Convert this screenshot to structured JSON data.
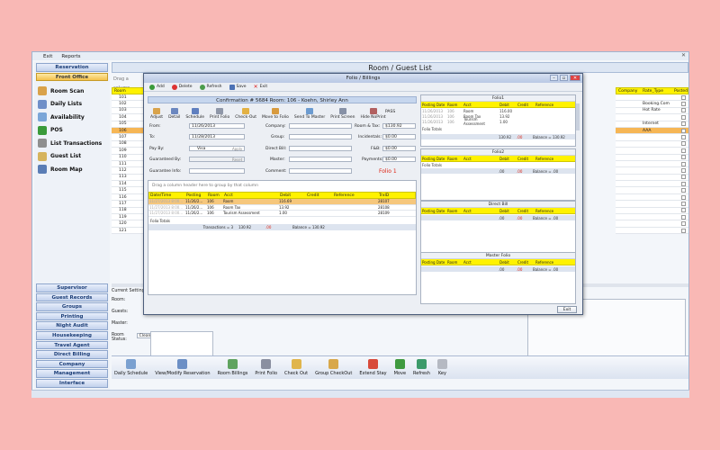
{
  "menubar": {
    "items": [
      "Exit",
      "Reports"
    ]
  },
  "sidebar": {
    "top_buttons": [
      "Reservation",
      "Front Office"
    ],
    "items": [
      "Room Scan",
      "Daily Lists",
      "Availability",
      "POS",
      "List Transactions",
      "Guest List",
      "Room Map"
    ],
    "bottom_buttons": [
      "Supervisor",
      "Guest Records",
      "Groups",
      "Printing",
      "Night Audit",
      "Housekeeping",
      "Travel Agent",
      "Direct Billing",
      "Company",
      "Management",
      "Interface"
    ]
  },
  "main": {
    "title": "Room / Guest List",
    "drag_hint": "Drag a column",
    "col_room": "Room",
    "col_company": "Company",
    "col_rate_type": "Rate_Type",
    "col_posted": "Posted",
    "rooms": [
      "101",
      "102",
      "103",
      "104",
      "105",
      "106",
      "107",
      "108",
      "109",
      "110",
      "111",
      "112",
      "113",
      "114",
      "115",
      "116",
      "117",
      "118",
      "119",
      "120",
      "121"
    ],
    "rate_types": {
      "r102": "Booking.Com",
      "r103": "Hot Rate",
      "r105": "Internet",
      "r106": "AAA"
    },
    "current_settings": "Current Settings",
    "lbl_room": "Room:",
    "lbl_guests": "Guests:",
    "lbl_master": "Master:",
    "lbl_room_status": "Room Status:",
    "room_status_val": "Clean",
    "lbl_room_notes": "Room Notes:",
    "company_notes": "Company Notes:",
    "save": "Save",
    "exit": "Exit"
  },
  "toolbar": [
    "Daily Schedule",
    "View/Modify Reservation",
    "Room Billings",
    "Print Folio",
    "Check Out",
    "Group CheckOut",
    "Extend Stay",
    "Move",
    "Refresh",
    "Key"
  ],
  "dialog": {
    "title": "Folio / Billings",
    "tb": [
      "Add",
      "Delete",
      "Refresh",
      "Save",
      "Exit"
    ],
    "confirmation": "Confirmation # 5684 Room: 106 -  Koehn, Shirley Ann",
    "actions": [
      "Adjust",
      "Detail",
      "Schedule",
      "Print Folio",
      "Check-Out",
      "Move to Folio",
      "Send To Master",
      "Print Screen",
      "Hide NoPrint"
    ],
    "pass": "PASS",
    "lbl_from": "From:",
    "from": "11/26/2013",
    "lbl_to": "To:",
    "to": "11/28/2013",
    "lbl_payby": "Pay By:",
    "payby": "Visa",
    "apply": "Apply",
    "lbl_guaranteed": "Guaranteed By:",
    "reset": "Reset",
    "lbl_guar_info": "Guarantee Info:",
    "lbl_company": "Company:",
    "lbl_group": "Group:",
    "lbl_directbill": "Direct Bill:",
    "lbl_master": "Master:",
    "lbl_comment": "Comment:",
    "lbl_roomtax": "Room & Tax:",
    "roomtax": "$130.92",
    "lbl_incidentals": "Incidentals:",
    "incidentals": "$0.00",
    "lbl_f&b": "F&B:",
    "fb": "$0.00",
    "lbl_payments": "Payments:",
    "payments": "$0.00",
    "folio_label": "Folio 1",
    "grid_hint": "Drag a column header here to group by that column",
    "grid_cols": [
      "Date/Time",
      "Posting",
      "Room",
      "Acct",
      "Debit",
      "Credit",
      "Reference",
      "TrxID"
    ],
    "grid_rows": [
      [
        "11/27/2013 8:00...",
        "11/26/2...",
        "106",
        "Room",
        "116.69",
        "",
        "",
        "28107"
      ],
      [
        "11/27/2013 8:00...",
        "11/26/2...",
        "106",
        "Room Tax",
        "13.92",
        "",
        "",
        "28108"
      ],
      [
        "11/27/2013 8:00...",
        "11/26/2...",
        "106",
        "Tourism Assessment",
        "1.00",
        "",
        "",
        "28109"
      ]
    ],
    "folio_totals": "Folio Totals",
    "transactions": "Transactions = 3",
    "debit_total": "130.92",
    "credit_total": ".00",
    "balance_total": "Balance = 130.92",
    "exit": "Exit",
    "folios": [
      {
        "title": "Folio1",
        "cols": [
          "Posting Date",
          "Room",
          "Acct",
          "Debit",
          "Credit",
          "Reference"
        ],
        "rows": [
          [
            "11/26/2013",
            "106",
            "Room",
            "116.00",
            "",
            ""
          ],
          [
            "11/26/2013",
            "106",
            "Room Tax",
            "13.92",
            "",
            ""
          ],
          [
            "11/26/2013",
            "106",
            "Tourism Assessment",
            "1.00",
            "",
            ""
          ]
        ],
        "totals": "Folio Totals",
        "debit": "130.92",
        "credit": ".00",
        "balance": "Balance = 130.92"
      },
      {
        "title": "Folio2",
        "cols": [
          "Posting Date",
          "Room",
          "Acct",
          "Debit",
          "Credit",
          "Reference"
        ],
        "rows": [],
        "totals": "Folio Totals",
        "debit": ".00",
        "credit": ".00",
        "balance": "Balance = .00"
      },
      {
        "title": "Direct Bill",
        "cols": [
          "Posting Date",
          "Room",
          "Acct",
          "Debit",
          "Credit",
          "Reference"
        ],
        "rows": [],
        "totals": "",
        "debit": ".00",
        "credit": ".00",
        "balance": "Balance = .00"
      },
      {
        "title": "Master Folio",
        "cols": [
          "Posting Date",
          "Room",
          "Acct",
          "Debit",
          "Credit",
          "Reference"
        ],
        "rows": [],
        "totals": "",
        "debit": ".00",
        "credit": ".00",
        "balance": "Balance = .00"
      }
    ]
  },
  "colors": {
    "accent_yellow": "#fff200",
    "selected_row": "#f6b655",
    "nav_blue": "#1d3f78",
    "folio_red": "#d21"
  }
}
